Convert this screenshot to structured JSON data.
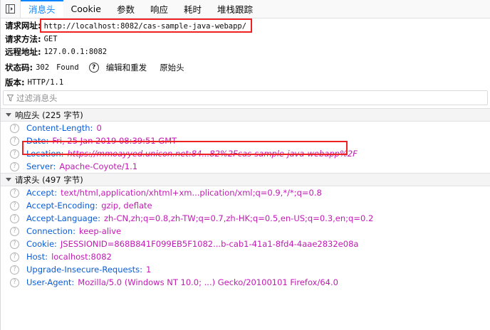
{
  "tabs": [
    {
      "label": "消息头",
      "active": true
    },
    {
      "label": "Cookie",
      "active": false
    },
    {
      "label": "参数",
      "active": false
    },
    {
      "label": "响应",
      "active": false
    },
    {
      "label": "耗时",
      "active": false
    },
    {
      "label": "堆栈跟踪",
      "active": false
    }
  ],
  "summary": {
    "url_label": "请求网址:",
    "url_value": "http://localhost:8082/cas-sample-java-webapp/",
    "method_label": "请求方法:",
    "method_value": "GET",
    "remote_label": "远程地址:",
    "remote_value": "127.0.0.1:8082",
    "status_label": "状态码:",
    "status_value": "302",
    "status_text": "Found",
    "help_glyph": "?",
    "edit_resend_label": "编辑和重发",
    "raw_headers_label": "原始头",
    "version_label": "版本:",
    "version_value": "HTTP/1.1"
  },
  "filter": {
    "placeholder": "过滤消息头"
  },
  "response_headers": {
    "title": "响应头 (225 字节)",
    "items": [
      {
        "name": "Content-Length:",
        "value": "0",
        "italic": false
      },
      {
        "name": "Date:",
        "value": "Fri, 25 Jan 2019 08:39:51 GMT",
        "italic": false
      },
      {
        "name": "Location:",
        "value": "https://mmoayyed.unicon.net:84...82%2Fcas-sample-java-webapp%2F",
        "italic": true
      },
      {
        "name": "Server:",
        "value": "Apache-Coyote/1.1",
        "italic": false
      }
    ]
  },
  "request_headers": {
    "title": "请求头 (497 字节)",
    "items": [
      {
        "name": "Accept:",
        "value": "text/html,application/xhtml+xm...plication/xml;q=0.9,*/*;q=0.8",
        "italic": false
      },
      {
        "name": "Accept-Encoding:",
        "value": "gzip, deflate",
        "italic": false
      },
      {
        "name": "Accept-Language:",
        "value": "zh-CN,zh;q=0.8,zh-TW;q=0.7,zh-HK;q=0.5,en-US;q=0.3,en;q=0.2",
        "italic": false
      },
      {
        "name": "Connection:",
        "value": "keep-alive",
        "italic": false
      },
      {
        "name": "Cookie:",
        "value": "JSESSIONID=868B841F099EB5F1082...b-cab1-41a1-8fd4-4aae2832e08a",
        "italic": false
      },
      {
        "name": "Host:",
        "value": "localhost:8082",
        "italic": false
      },
      {
        "name": "Upgrade-Insecure-Requests:",
        "value": "1",
        "italic": false
      },
      {
        "name": "User-Agent:",
        "value": "Mozilla/5.0 (Windows NT 10.0; ...) Gecko/20100101 Firefox/64.0",
        "italic": false
      }
    ]
  },
  "icons": {
    "panel_toggle": "sidebar-toggle-icon",
    "filter": "funnel-icon",
    "header_help": "question-circle-icon"
  },
  "colors": {
    "accent": "#0a84ff",
    "header_name": "#0a5dd6",
    "header_value": "#c11ab4",
    "highlight_box": "#ee2222"
  }
}
